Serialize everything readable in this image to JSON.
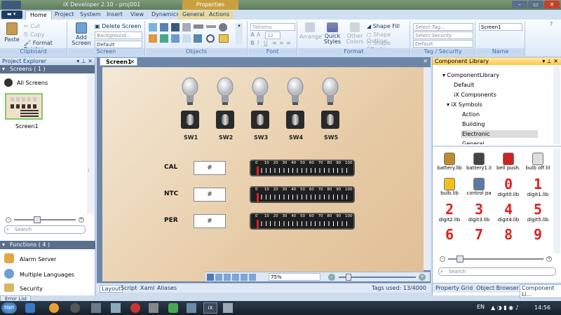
{
  "window": {
    "title": "iX Developer 2.10 - proj001",
    "contextual_tab": "Properties"
  },
  "menu": {
    "app_button": "",
    "tabs": [
      "Home",
      "Project",
      "System",
      "Insert",
      "View",
      "Dynamics",
      "General",
      "Actions"
    ]
  },
  "ribbon": {
    "clipboard": {
      "paste": "Paste",
      "cut": "Cut",
      "copy": "Copy",
      "format_painter": "Format Painter",
      "label": "Clipboard"
    },
    "screen": {
      "add_screen": "Add Screen",
      "delete_screen": "Delete Screen",
      "background": "Background...",
      "template": "Default",
      "label": "Screen"
    },
    "objects": {
      "label": "Objects"
    },
    "font": {
      "family": "Tahoma",
      "size": "12",
      "label": "Font"
    },
    "format": {
      "arrange": "Arrange",
      "quick_styles": "Quick Styles",
      "other_colors": "Other Colors",
      "shape_fill": "Shape Fill",
      "shape_outline": "Shape Outline",
      "shape_effects": "Shape Effects",
      "label": "Format"
    },
    "tag_security": {
      "select_tag": "Select Tag...",
      "select_security": "Select Security Groups...",
      "default": "Default",
      "label": "Tag / Security"
    },
    "name": {
      "value": "Screen1",
      "label": "Name"
    }
  },
  "project_explorer": {
    "title": "Project Explorer",
    "screens_header": "Screens ( 1 )",
    "all_screens": "All Screens",
    "screen_name": "Screen1",
    "search_placeholder": "Search",
    "functions_header": "Functions ( 4 )",
    "functions": [
      "Alarm Server",
      "Multiple Languages",
      "Security"
    ]
  },
  "editor": {
    "tab": "Screen1",
    "switches": [
      "SW1",
      "SW2",
      "SW3",
      "SW4",
      "SW5"
    ],
    "rows": [
      {
        "label": "CAL",
        "value": "#"
      },
      {
        "label": "NTC",
        "value": "#"
      },
      {
        "label": "PER",
        "value": "#"
      }
    ],
    "ticks": [
      "0",
      "10",
      "20",
      "30",
      "40",
      "50",
      "60",
      "70",
      "80",
      "90",
      "100"
    ],
    "zoom": "75%",
    "bottom_tabs": [
      "Layout",
      "Script",
      "Xaml",
      "Aliases"
    ],
    "tags_used": "Tags used: 13/4000"
  },
  "component_library": {
    "title": "Component Library",
    "tree": [
      "ComponentLibrary",
      "Default",
      "iX Components",
      "iX Symbols",
      "Action",
      "Building",
      "Electronic",
      "General"
    ],
    "items": [
      {
        "label": "battery.lib",
        "glyph": ""
      },
      {
        "label": "battery1.li",
        "glyph": ""
      },
      {
        "label": "bell push.",
        "glyph": ""
      },
      {
        "label": "bulb off.lil",
        "glyph": ""
      },
      {
        "label": "bulb.lib",
        "glyph": ""
      },
      {
        "label": "control pa",
        "glyph": ""
      },
      {
        "label": "digit0.lib",
        "glyph": "0"
      },
      {
        "label": "digit1.lib",
        "glyph": "1"
      },
      {
        "label": "digit2.lib",
        "glyph": "2"
      },
      {
        "label": "digit3.lib",
        "glyph": "3"
      },
      {
        "label": "digit4.lib",
        "glyph": "4"
      },
      {
        "label": "digit5.lib",
        "glyph": "5"
      },
      {
        "label": "",
        "glyph": "6"
      },
      {
        "label": "",
        "glyph": "7"
      },
      {
        "label": "",
        "glyph": "8"
      },
      {
        "label": "",
        "glyph": "9"
      }
    ],
    "search_placeholder": "Search",
    "bottom_tabs": [
      "Property Grid",
      "Object Browser",
      "Component Li..."
    ]
  },
  "error_list": "Error List",
  "taskbar": {
    "start": "Start",
    "lang": "EN",
    "clock": "14:56"
  }
}
